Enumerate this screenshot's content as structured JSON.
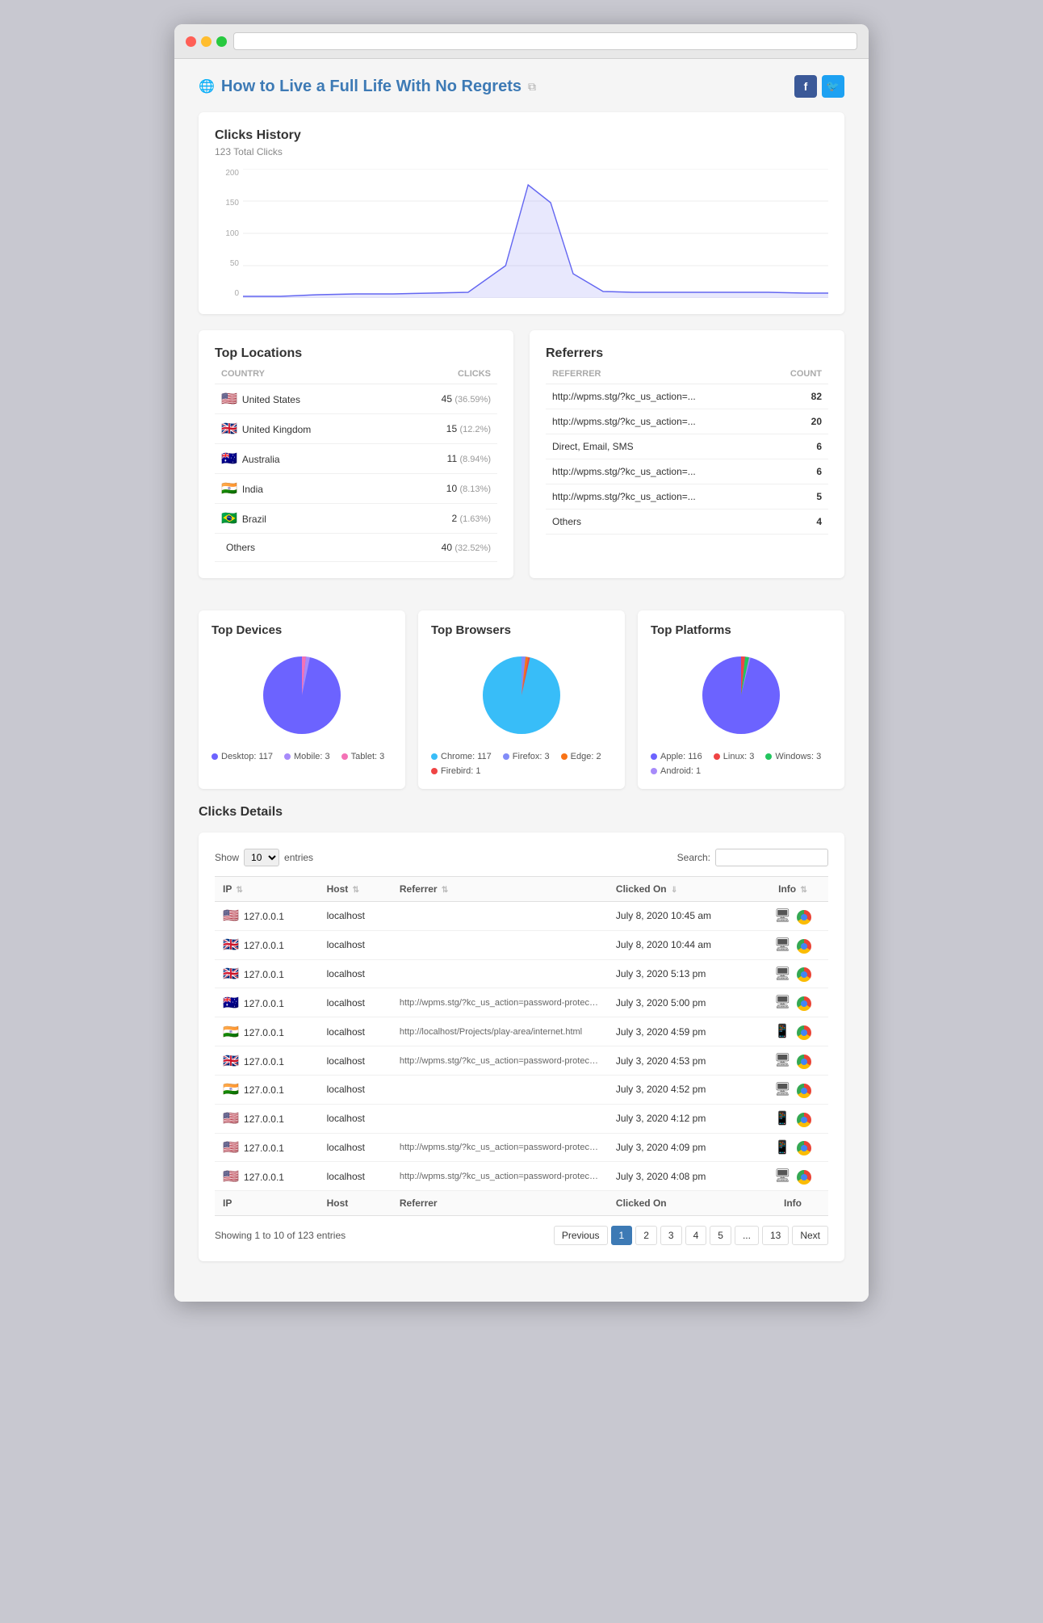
{
  "browser": {
    "address_bar": ""
  },
  "header": {
    "title": "How to Live a Full Life With No Regrets",
    "social": {
      "facebook": "f",
      "twitter": "t"
    }
  },
  "clicks_history": {
    "title": "Clicks History",
    "subtitle": "123 Total Clicks",
    "y_labels": [
      "200",
      "150",
      "100",
      "50",
      "0"
    ]
  },
  "top_locations": {
    "title": "Top Locations",
    "col_country": "COUNTRY",
    "col_clicks": "CLICKS",
    "rows": [
      {
        "flag": "🇺🇸",
        "country": "United States",
        "clicks": 45,
        "pct": "36.59%"
      },
      {
        "flag": "🇬🇧",
        "country": "United Kingdom",
        "clicks": 15,
        "pct": "12.2%"
      },
      {
        "flag": "🇦🇺",
        "country": "Australia",
        "clicks": 11,
        "pct": "8.94%"
      },
      {
        "flag": "🇮🇳",
        "country": "India",
        "clicks": 10,
        "pct": "8.13%"
      },
      {
        "flag": "🇧🇷",
        "country": "Brazil",
        "clicks": 2,
        "pct": "1.63%"
      },
      {
        "flag": "",
        "country": "Others",
        "clicks": 40,
        "pct": "32.52%"
      }
    ]
  },
  "referrers": {
    "title": "Referrers",
    "col_referrer": "REFERRER",
    "col_count": "COUNT",
    "rows": [
      {
        "referrer": "http://wpms.stg/?kc_us_action=...",
        "count": 82
      },
      {
        "referrer": "http://wpms.stg/?kc_us_action=...",
        "count": 20
      },
      {
        "referrer": "Direct, Email, SMS",
        "count": 6
      },
      {
        "referrer": "http://wpms.stg/?kc_us_action=...",
        "count": 6
      },
      {
        "referrer": "http://wpms.stg/?kc_us_action=...",
        "count": 5
      },
      {
        "referrer": "Others",
        "count": 4
      }
    ]
  },
  "top_devices": {
    "title": "Top Devices",
    "legend": [
      {
        "label": "Desktop: 117",
        "color": "#6c63ff"
      },
      {
        "label": "Mobile: 3",
        "color": "#a78bfa"
      },
      {
        "label": "Tablet: 3",
        "color": "#f472b6"
      }
    ]
  },
  "top_browsers": {
    "title": "Top Browsers",
    "legend": [
      {
        "label": "Chrome: 117",
        "color": "#38bdf8"
      },
      {
        "label": "Firefox: 3",
        "color": "#818cf8"
      },
      {
        "label": "Edge: 2",
        "color": "#f97316"
      },
      {
        "label": "Firebird: 1",
        "color": "#ef4444"
      }
    ]
  },
  "top_platforms": {
    "title": "Top Platforms",
    "legend": [
      {
        "label": "Apple: 116",
        "color": "#6c63ff"
      },
      {
        "label": "Linux: 3",
        "color": "#ef4444"
      },
      {
        "label": "Windows: 3",
        "color": "#22c55e"
      },
      {
        "label": "Android: 1",
        "color": "#a78bfa"
      }
    ]
  },
  "clicks_details": {
    "title": "Clicks Details",
    "show_label": "Show",
    "entries_label": "entries",
    "search_label": "Search:",
    "show_value": "10",
    "col_ip": "IP",
    "col_host": "Host",
    "col_referrer": "Referrer",
    "col_clicked_on": "Clicked On",
    "col_info": "Info",
    "rows": [
      {
        "flag": "🇺🇸",
        "ip": "127.0.0.1",
        "host": "localhost",
        "referrer": "",
        "clicked_on": "July 8, 2020 10:45 am",
        "device": "desktop",
        "browser": "chrome"
      },
      {
        "flag": "🇬🇧",
        "ip": "127.0.0.1",
        "host": "localhost",
        "referrer": "",
        "clicked_on": "July 8, 2020 10:44 am",
        "device": "desktop",
        "browser": "chrome"
      },
      {
        "flag": "🇬🇧",
        "ip": "127.0.0.1",
        "host": "localhost",
        "referrer": "",
        "clicked_on": "July 3, 2020 5:13 pm",
        "device": "desktop",
        "browser": "chrome"
      },
      {
        "flag": "🇦🇺",
        "ip": "127.0.0.1",
        "host": "localhost",
        "referrer": "http://wpms.stg/?kc_us_action=password-protection&...",
        "clicked_on": "July 3, 2020 5:00 pm",
        "device": "desktop",
        "browser": "chrome"
      },
      {
        "flag": "🇮🇳",
        "ip": "127.0.0.1",
        "host": "localhost",
        "referrer": "http://localhost/Projects/play-area/internet.html",
        "clicked_on": "July 3, 2020 4:59 pm",
        "device": "mobile",
        "browser": "chrome"
      },
      {
        "flag": "🇬🇧",
        "ip": "127.0.0.1",
        "host": "localhost",
        "referrer": "http://wpms.stg/?kc_us_action=password-protection&...",
        "clicked_on": "July 3, 2020 4:53 pm",
        "device": "desktop",
        "browser": "chrome"
      },
      {
        "flag": "🇮🇳",
        "ip": "127.0.0.1",
        "host": "localhost",
        "referrer": "",
        "clicked_on": "July 3, 2020 4:52 pm",
        "device": "desktop",
        "browser": "chrome"
      },
      {
        "flag": "🇺🇸",
        "ip": "127.0.0.1",
        "host": "localhost",
        "referrer": "",
        "clicked_on": "July 3, 2020 4:12 pm",
        "device": "mobile",
        "browser": "chrome"
      },
      {
        "flag": "🇺🇸",
        "ip": "127.0.0.1",
        "host": "localhost",
        "referrer": "http://wpms.stg/?kc_us_action=password-protection&...",
        "clicked_on": "July 3, 2020 4:09 pm",
        "device": "tablet",
        "browser": "chrome"
      },
      {
        "flag": "🇺🇸",
        "ip": "127.0.0.1",
        "host": "localhost",
        "referrer": "http://wpms.stg/?kc_us_action=password-protection&...",
        "clicked_on": "July 3, 2020 4:08 pm",
        "device": "desktop",
        "browser": "chrome"
      }
    ],
    "footer_showing": "Showing 1 to 10 of 123 entries",
    "pagination": {
      "previous": "Previous",
      "next": "Next",
      "pages": [
        "1",
        "2",
        "3",
        "4",
        "5",
        "...",
        "13"
      ]
    }
  }
}
